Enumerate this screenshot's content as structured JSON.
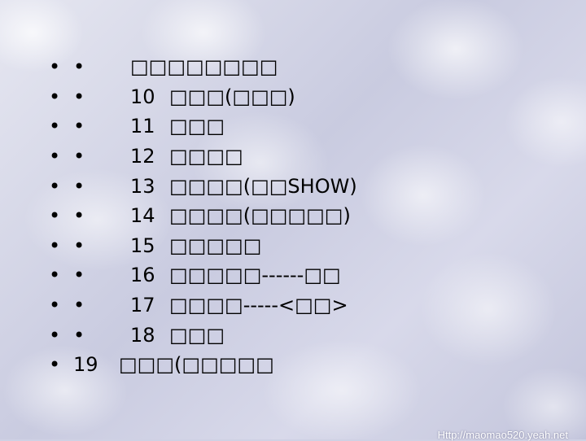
{
  "items": [
    {
      "bullet": "•",
      "sub_bullet": "•",
      "number": "",
      "text": "□□□□□□□□"
    },
    {
      "bullet": "•",
      "sub_bullet": "•",
      "number": "10",
      "text": "□□□(□□□)"
    },
    {
      "bullet": "•",
      "sub_bullet": "•",
      "number": "11",
      "text": "□□□"
    },
    {
      "bullet": "•",
      "sub_bullet": "•",
      "number": "12",
      "text": "□□□□"
    },
    {
      "bullet": "•",
      "sub_bullet": "•",
      "number": "13",
      "text": "□□□□(□□SHOW)"
    },
    {
      "bullet": "•",
      "sub_bullet": "•",
      "number": "14",
      "text": "□□□□(□□□□□)"
    },
    {
      "bullet": "•",
      "sub_bullet": "•",
      "number": "15",
      "text": "□□□□□"
    },
    {
      "bullet": "•",
      "sub_bullet": "•",
      "number": "16",
      "text": "□□□□□------□□"
    },
    {
      "bullet": "•",
      "sub_bullet": "•",
      "number": "17",
      "text": "□□□□-----<□□>"
    },
    {
      "bullet": "•",
      "sub_bullet": "•",
      "number": "18",
      "text": "□□□"
    }
  ],
  "last_item": {
    "bullet": "•",
    "number": "19",
    "text": "□□□(□□□□□"
  },
  "watermark": "Http://maomao520.yeah.net"
}
